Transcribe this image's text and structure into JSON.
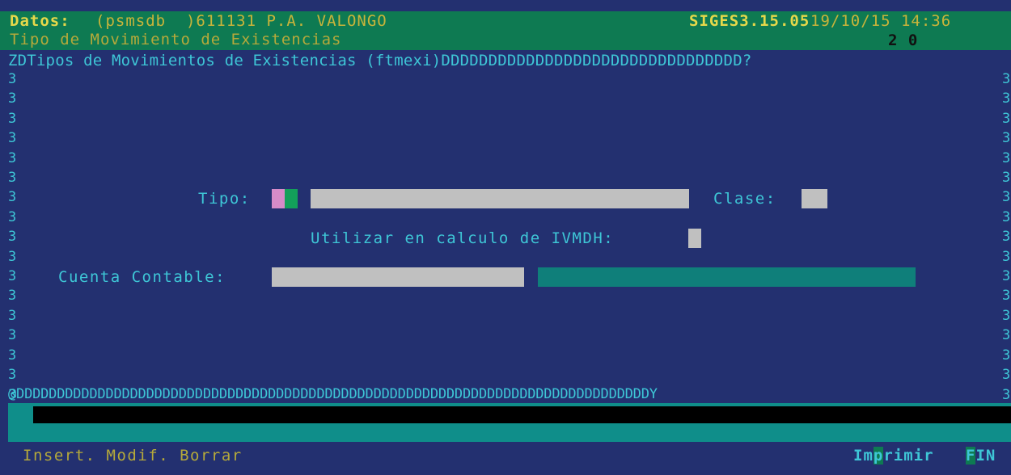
{
  "header": {
    "datos_label": "Datos:",
    "datos_value": "(psmsdb  )611131 P.A. VALONGO",
    "version": "SIGES3.15.05",
    "datetime": "19/10/15 14:36",
    "subtitle": "Tipo de Movimiento de Existencias",
    "counter": "2 0"
  },
  "window": {
    "top_border": "ZDTipos de Movimientos de Existencias (ftmexi)DDDDDDDDDDDDDDDDDDDDDDDDDDDDDDDD?",
    "left_border": "3\n3\n3\n3\n3\n3\n3\n3\n3\n3\n3\n3\n3\n3\n3\n3\n3",
    "right_border": "3\n3\n3\n3\n3\n3\n3\n3\n3\n3\n3\n3\n3\n3\n3\n3\n3",
    "bottom_border": "@DDDDDDDDDDDDDDDDDDDDDDDDDDDDDDDDDDDDDDDDDDDDDDDDDDDDDDDDDDDDDDDDDDDDDDDDDDDDDDY"
  },
  "form": {
    "tipo_label": "Tipo:",
    "clase_label": "Clase:",
    "ivmdh_label": "Utilizar en calculo de IVMDH:",
    "cuenta_label": "Cuenta Contable:"
  },
  "footer": {
    "actions": "Insert. Modif. Borrar",
    "imprimir_pre": "Im",
    "imprimir_hot": "p",
    "imprimir_post": "rimir",
    "fin_hot": "F",
    "fin_post": "IN"
  },
  "colors": {
    "background": "#233070",
    "header_green": "#0e7a52",
    "accent_cyan": "#3ec6d6",
    "field_gray": "#c0c0c0",
    "teal_field": "#0f7f7a"
  }
}
